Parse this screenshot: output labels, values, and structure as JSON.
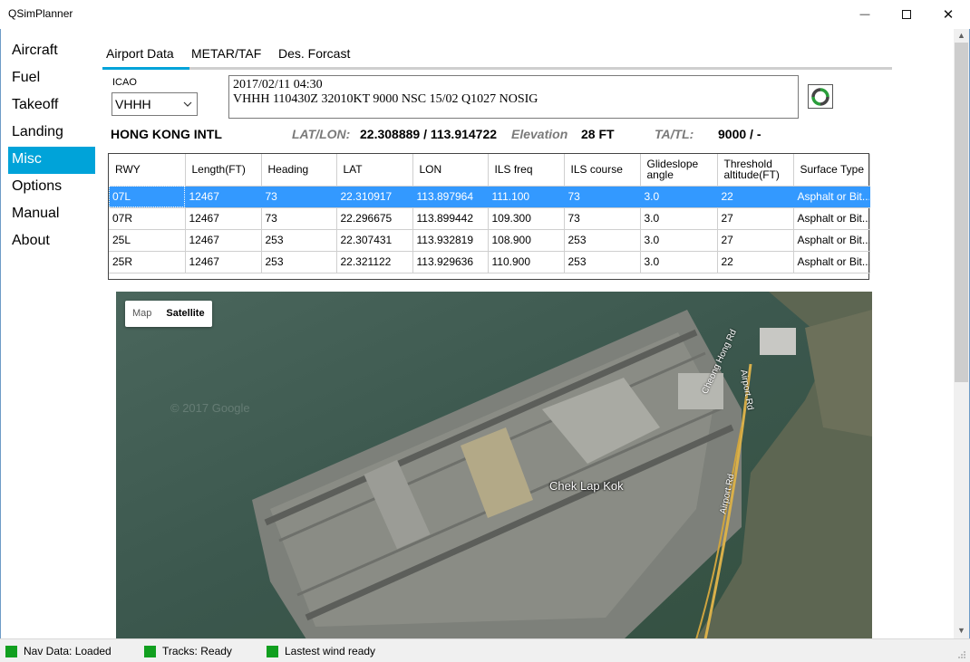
{
  "window": {
    "title": "QSimPlanner",
    "minimize_glyph": "—",
    "close_glyph": "✕"
  },
  "sidebar": {
    "items": [
      {
        "label": "Aircraft"
      },
      {
        "label": "Fuel"
      },
      {
        "label": "Takeoff"
      },
      {
        "label": "Landing"
      },
      {
        "label": "Misc",
        "active": true
      },
      {
        "label": "Options"
      },
      {
        "label": "Manual"
      },
      {
        "label": "About"
      }
    ]
  },
  "tabs": [
    {
      "label": "Airport Data",
      "active": true
    },
    {
      "label": "METAR/TAF"
    },
    {
      "label": "Des. Forcast"
    }
  ],
  "icao": {
    "label": "ICAO",
    "value": "VHHH"
  },
  "metar": {
    "line1": "2017/02/11 04:30",
    "line2": "VHHH 110430Z 32010KT 9000 NSC 15/02 Q1027 NOSIG"
  },
  "airport": {
    "name": "HONG KONG INTL",
    "latlon_label": "LAT/LON:",
    "latlon_value": "22.308889 / 113.914722",
    "elevation_label": "Elevation",
    "elevation_value": "28 FT",
    "tatl_label": "TA/TL:",
    "tatl_value": "9000 / -"
  },
  "runway_table": {
    "headers": [
      "RWY",
      "Length(FT)",
      "Heading",
      "LAT",
      "LON",
      "ILS freq",
      "ILS course",
      "Glideslope angle",
      "Threshold altitude(FT)",
      "Surface Type"
    ],
    "rows": [
      [
        "07L",
        "12467",
        "73",
        "22.310917",
        "113.897964",
        "111.100",
        "73",
        "3.0",
        "22",
        "Asphalt or Bit..."
      ],
      [
        "07R",
        "12467",
        "73",
        "22.296675",
        "113.899442",
        "109.300",
        "73",
        "3.0",
        "27",
        "Asphalt or Bit..."
      ],
      [
        "25L",
        "12467",
        "253",
        "22.307431",
        "113.932819",
        "108.900",
        "253",
        "3.0",
        "27",
        "Asphalt or Bit..."
      ],
      [
        "25R",
        "12467",
        "253",
        "22.321122",
        "113.929636",
        "110.900",
        "253",
        "3.0",
        "22",
        "Asphalt or Bit..."
      ]
    ],
    "selected_row": 0
  },
  "map": {
    "toggle_map": "Map",
    "toggle_satellite": "Satellite",
    "place_label": "Chek Lap Kok",
    "road_labels": [
      "Cheong Hong Rd",
      "Airport Rd",
      "Airport Rd"
    ],
    "watermark": "© 2017 Google"
  },
  "status": [
    {
      "label": "Nav Data: Loaded"
    },
    {
      "label": "Tracks: Ready"
    },
    {
      "label": "Lastest wind ready"
    }
  ],
  "colors": {
    "accent": "#00a3d9",
    "selection": "#3399ff",
    "status_ok": "#119f1f"
  }
}
